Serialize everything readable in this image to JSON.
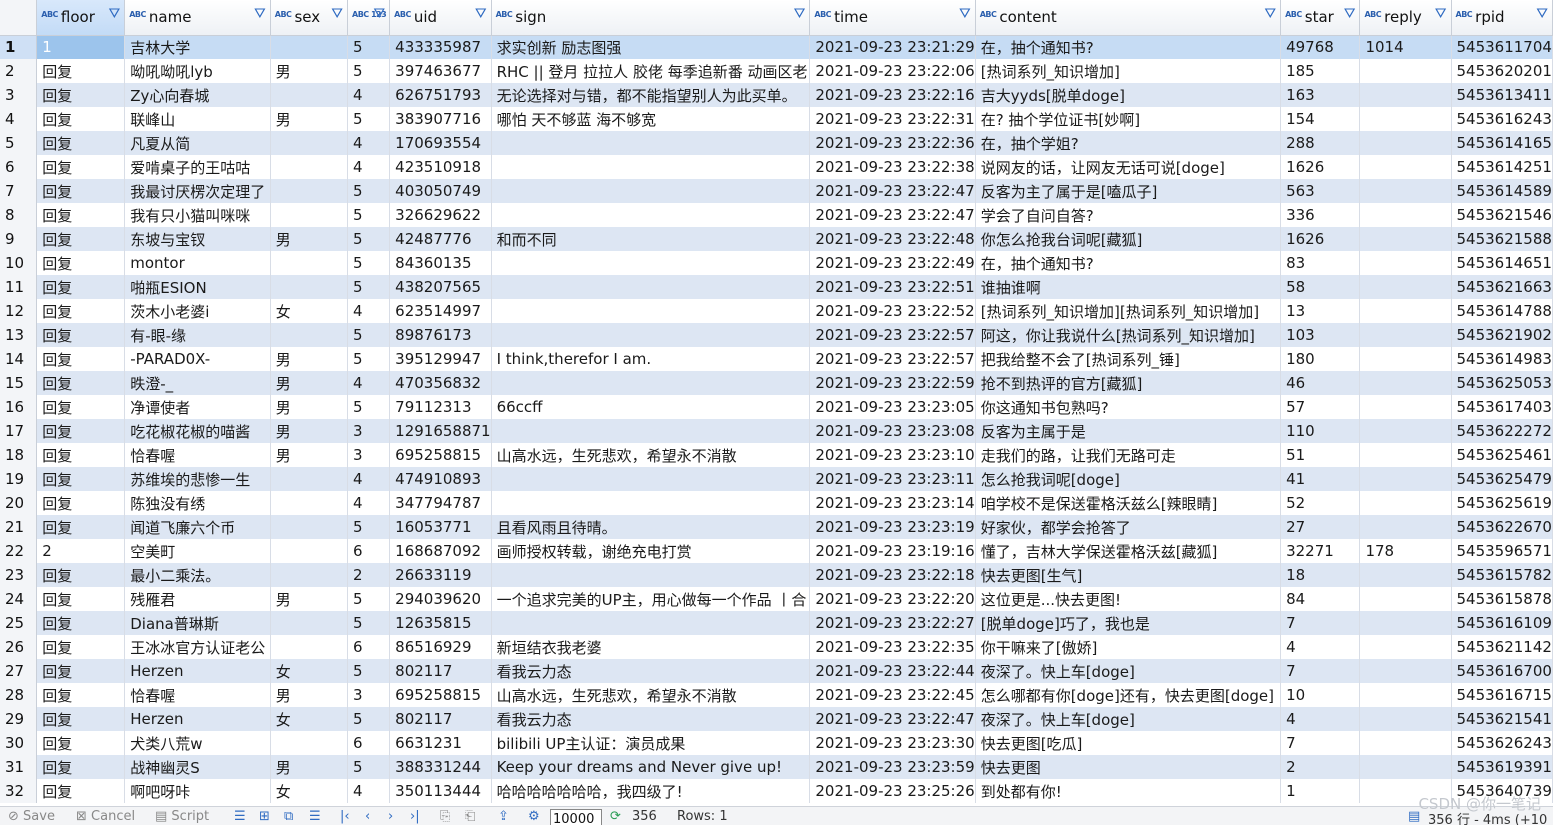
{
  "columns": [
    {
      "label": "floor",
      "type": "ABC"
    },
    {
      "label": "name",
      "type": "ABC"
    },
    {
      "label": "sex",
      "type": "ABC"
    },
    {
      "label": "",
      "type": "ABC 123"
    },
    {
      "label": "uid",
      "type": "ABC"
    },
    {
      "label": "sign",
      "type": "ABC"
    },
    {
      "label": "time",
      "type": "ABC"
    },
    {
      "label": "content",
      "type": "ABC"
    },
    {
      "label": "star",
      "type": "ABC"
    },
    {
      "label": "reply",
      "type": "ABC"
    },
    {
      "label": "rpid",
      "type": "ABC"
    }
  ],
  "rows": [
    [
      "1",
      "1",
      "吉林大学",
      "",
      "5",
      "433335987",
      "求实创新 励志图强",
      "2021-09-23 23:21:29",
      "在，抽个通知书?",
      "49768",
      "1014",
      "5453611704"
    ],
    [
      "2",
      "回复",
      "呦吼呦吼lyb",
      "男",
      "5",
      "397463677",
      "RHC || 登月 拉拉人 胶佬 每季追新番 动画区老",
      "2021-09-23 23:22:06",
      "[热词系列_知识增加]",
      "185",
      "",
      "5453620201"
    ],
    [
      "3",
      "回复",
      "Zy心向春城",
      "",
      "4",
      "626751793",
      "无论选择对与错，都不能指望别人为此买单。",
      "2021-09-23 23:22:16",
      "吉大yyds[脱单doge]",
      "163",
      "",
      "5453613411"
    ],
    [
      "4",
      "回复",
      "联峰山",
      "男",
      "5",
      "383907716",
      "哪怕 天不够蓝 海不够宽",
      "2021-09-23 23:22:31",
      "在? 抽个学位证书[妙啊]",
      "154",
      "",
      "5453616243"
    ],
    [
      "5",
      "回复",
      "凡夏从简",
      "",
      "4",
      "170693554",
      "",
      "2021-09-23 23:22:36",
      "在，抽个学姐?",
      "288",
      "",
      "5453614165"
    ],
    [
      "6",
      "回复",
      "爱啃桌子的王咕咕",
      "",
      "4",
      "423510918",
      "",
      "2021-09-23 23:22:38",
      "说网友的话，让网友无话可说[doge]",
      "1626",
      "",
      "5453614251"
    ],
    [
      "7",
      "回复",
      "我最讨厌楞次定理了",
      "",
      "5",
      "403050749",
      "",
      "2021-09-23 23:22:47",
      "反客为主了属于是[嗑瓜子]",
      "563",
      "",
      "5453614589"
    ],
    [
      "8",
      "回复",
      "我有只小猫叫咪咪",
      "",
      "5",
      "326629622",
      "",
      "2021-09-23 23:22:47",
      "学会了自问自答?",
      "336",
      "",
      "5453621546"
    ],
    [
      "9",
      "回复",
      "东坡与宝钗",
      "男",
      "5",
      "42487776",
      "和而不同",
      "2021-09-23 23:22:48",
      "你怎么抢我台词呢[藏狐]",
      "1626",
      "",
      "5453621588"
    ],
    [
      "10",
      "回复",
      "montor",
      "",
      "5",
      "84360135",
      "",
      "2021-09-23 23:22:49",
      "在，抽个通知书?",
      "83",
      "",
      "5453614651"
    ],
    [
      "11",
      "回复",
      "啪瓶ESION",
      "",
      "5",
      "438207565",
      "",
      "2021-09-23 23:22:51",
      "谁抽谁啊",
      "58",
      "",
      "5453621663"
    ],
    [
      "12",
      "回复",
      "茨木小老婆i",
      "女",
      "4",
      "623514997",
      "",
      "2021-09-23 23:22:52",
      "[热词系列_知识增加][热词系列_知识增加]",
      "13",
      "",
      "5453614788"
    ],
    [
      "13",
      "回复",
      "有-眼-缘",
      "",
      "5",
      "89876173",
      "",
      "2021-09-23 23:22:57",
      "阿这，你让我说什么[热词系列_知识增加]",
      "103",
      "",
      "5453621902"
    ],
    [
      "14",
      "回复",
      "-PARAD0X-",
      "男",
      "5",
      "395129947",
      "I think,therefor I am.",
      "2021-09-23 23:22:57",
      "把我给整不会了[热词系列_锤]",
      "180",
      "",
      "5453614983"
    ],
    [
      "15",
      "回复",
      "昳澄-_",
      "男",
      "4",
      "470356832",
      "",
      "2021-09-23 23:22:59",
      "抢不到热评的官方[藏狐]",
      "46",
      "",
      "5453625053"
    ],
    [
      "16",
      "回复",
      "净谭使者",
      "男",
      "5",
      "79112313",
      "66ccff",
      "2021-09-23 23:23:05",
      "你这通知书包熟吗?",
      "57",
      "",
      "5453617403"
    ],
    [
      "17",
      "回复",
      "吃花椒花椒的喵酱",
      "男",
      "3",
      "1291658871",
      "",
      "2021-09-23 23:23:08",
      "反客为主属于是",
      "110",
      "",
      "5453622272"
    ],
    [
      "18",
      "回复",
      "恰春喔",
      "男",
      "3",
      "695258815",
      "山高水远，生死悲欢，希望永不消散",
      "2021-09-23 23:23:10",
      "走我们的路，让我们无路可走",
      "51",
      "",
      "5453625461"
    ],
    [
      "19",
      "回复",
      "苏维埃的悲惨一生",
      "",
      "4",
      "474910893",
      "",
      "2021-09-23 23:23:11",
      "怎么抢我词呢[doge]",
      "41",
      "",
      "5453625479"
    ],
    [
      "20",
      "回复",
      "陈独没有绣",
      "",
      "4",
      "347794787",
      "",
      "2021-09-23 23:23:14",
      "咱学校不是保送霍格沃兹么[辣眼睛]",
      "52",
      "",
      "5453625619"
    ],
    [
      "21",
      "回复",
      "闻道飞廉六个币",
      "",
      "5",
      "16053771",
      "且看风雨且待晴。",
      "2021-09-23 23:23:19",
      "好家伙，都学会抢答了",
      "27",
      "",
      "5453622670"
    ],
    [
      "22",
      "2",
      "空美町",
      "",
      "6",
      "168687092",
      "画师授权转载，谢绝充电打赏",
      "2021-09-23 23:19:16",
      "懂了，吉林大学保送霍格沃兹[藏狐]",
      "32271",
      "178",
      "5453596571"
    ],
    [
      "23",
      "回复",
      "最小二乘法。",
      "",
      "2",
      "26633119",
      "",
      "2021-09-23 23:22:18",
      "快去更图[生气]",
      "18",
      "",
      "5453615782"
    ],
    [
      "24",
      "回复",
      "残雁君",
      "男",
      "5",
      "294039620",
      "一个追求完美的UP主，用心做每一个作品 丨合",
      "2021-09-23 23:22:20",
      "这位更是...快去更图!",
      "84",
      "",
      "5453615878"
    ],
    [
      "25",
      "回复",
      "Diana普琳斯",
      "",
      "5",
      "12635815",
      "",
      "2021-09-23 23:22:27",
      "[脱单doge]巧了，我也是",
      "7",
      "",
      "5453616109"
    ],
    [
      "26",
      "回复",
      "王冰冰官方认证老公",
      "",
      "6",
      "86516929",
      "新垣结衣我老婆",
      "2021-09-23 23:22:35",
      "你干嘛来了[傲娇]",
      "4",
      "",
      "5453621142"
    ],
    [
      "27",
      "回复",
      "Herzen",
      "女",
      "5",
      "802117",
      "看我云力态",
      "2021-09-23 23:22:44",
      "夜深了。快上车[doge]",
      "7",
      "",
      "5453616700"
    ],
    [
      "28",
      "回复",
      "恰春喔",
      "男",
      "3",
      "695258815",
      "山高水远，生死悲欢，希望永不消散",
      "2021-09-23 23:22:45",
      "怎么哪都有你[doge]还有，快去更图[doge]",
      "10",
      "",
      "5453616715"
    ],
    [
      "29",
      "回复",
      "Herzen",
      "女",
      "5",
      "802117",
      "看我云力态",
      "2021-09-23 23:22:47",
      "夜深了。快上车[doge]",
      "4",
      "",
      "5453621541"
    ],
    [
      "30",
      "回复",
      "犬类八荒w",
      "",
      "6",
      "6631231",
      "bilibili UP主认证：演员成果",
      "2021-09-23 23:23:30",
      "快去更图[吃瓜]",
      "7",
      "",
      "5453626243"
    ],
    [
      "31",
      "回复",
      "战神幽灵S",
      "男",
      "5",
      "388331244",
      "Keep your dreams and Never give up!",
      "2021-09-23 23:23:59",
      "快去更图",
      "2",
      "",
      "5453619391"
    ],
    [
      "32",
      "回复",
      "啊吧呀咔",
      "女",
      "4",
      "350113444",
      "哈哈哈哈哈哈哈，我四级了!",
      "2021-09-23 23:25:26",
      "到处都有你!",
      "1",
      "",
      "5453640739"
    ]
  ],
  "statusbar": {
    "save": "Save",
    "cancel": "Cancel",
    "script": "Script",
    "fetch_size": "10000",
    "fetched_count": "356",
    "rows_label": "Rows: 1",
    "summary": "356 行 - 4ms (+10"
  },
  "watermark": "CSDN @你一笔记",
  "colors": {
    "header_accent": "#2f6bc2",
    "row_alt": "#dde6f3",
    "selected_row": "#c6dcf4"
  }
}
